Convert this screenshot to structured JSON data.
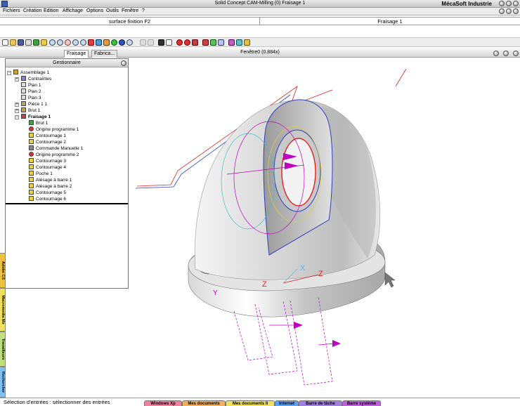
{
  "window": {
    "title": "Solid Concept CAM-Milling (0) Fraisage 1",
    "brand": "MécaSoft Industrie"
  },
  "menu": [
    "Fichiers",
    "Création",
    "Edition",
    "Affichage",
    "Options",
    "Outils",
    "Fenêtre",
    "?"
  ],
  "info": {
    "left": "surface finition F2",
    "right": "Fraisage 1"
  },
  "tabs": {
    "fraisage": "Fraisage",
    "fabrication": "Fabrica..."
  },
  "view": {
    "title": "Fenêtre0 (0.884x)"
  },
  "manager": {
    "title": "Gestionnaire",
    "items": [
      "Assemblage 1",
      "Contraintes",
      "Plan 1",
      "Plan 2",
      "Plan 3",
      "Pièce 1 1",
      "Brut 1",
      "Fraisage 1",
      "Brut 1",
      "Origine programme 1",
      "Contournage 1",
      "Contournage 2",
      "Commande Manuelle 1",
      "Origine programme 2",
      "Contournage 3",
      "Contournage 4",
      "Poche 1",
      "Alésage à barre 1",
      "Alésage à barre 2",
      "Contournage 5",
      "Contournage 6"
    ]
  },
  "side_tabs": [
    "Adobe CS",
    "Macromedia Mx",
    "Travailleurs",
    "Rechercher"
  ],
  "status": {
    "text": "Sélection d'entrées : sélectionner des entrées"
  },
  "taskbar": [
    "Windows Xp",
    "Mes documents",
    "Mes documents II",
    "Internet",
    "Barre de tâche",
    "Barre système"
  ],
  "axes": {
    "x": "X",
    "y": "Y",
    "z": "Z",
    "z2": "Z",
    "x2": "X"
  },
  "colors": {
    "accent": "#3c5fb0",
    "toolpath": "#c000c0",
    "wire_red": "#e02020",
    "wire_blue": "#3040c0"
  }
}
